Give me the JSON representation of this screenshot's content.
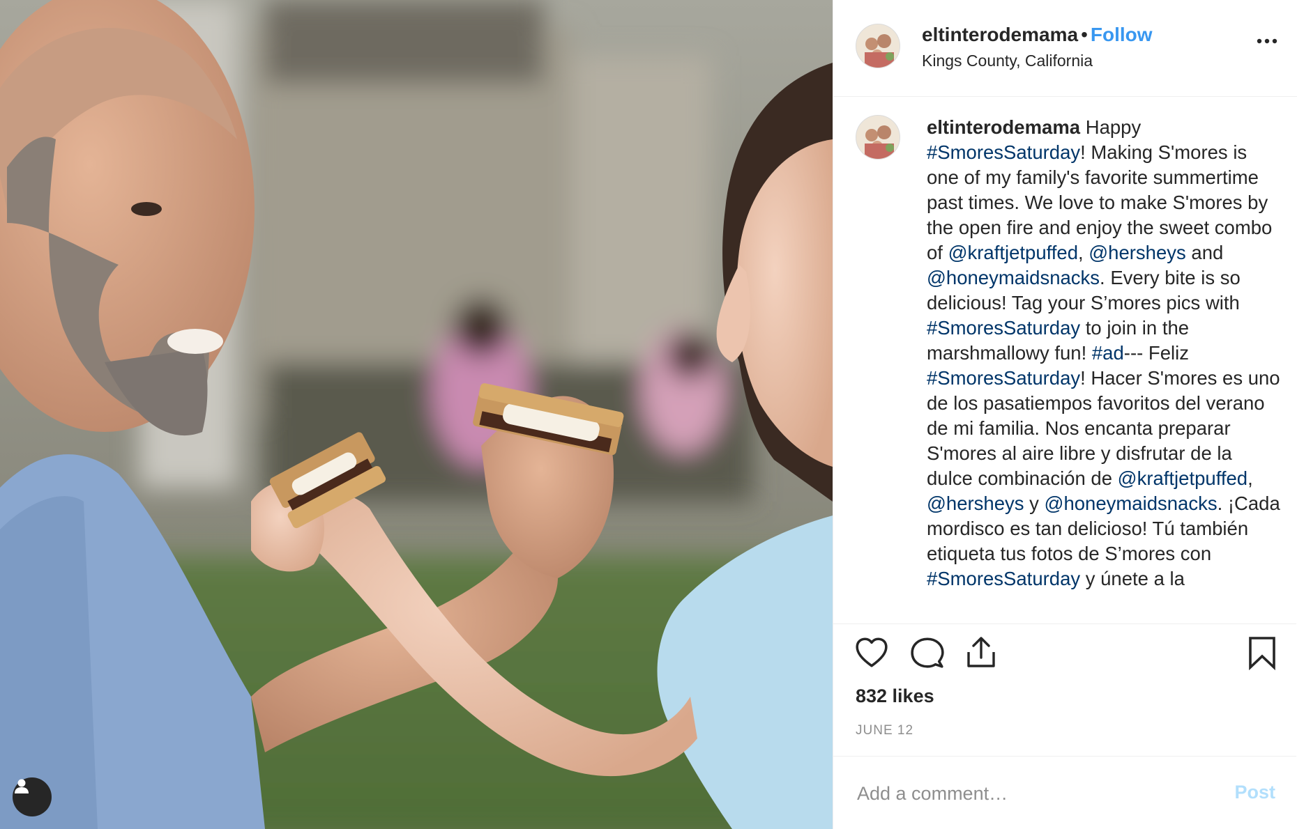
{
  "post": {
    "username": "eltinterodemama",
    "separator": "•",
    "follow_label": "Follow",
    "location": "Kings County, California",
    "more_icon": "more-horizontal-icon",
    "caption": [
      {
        "t": "text",
        "v": " Happy "
      },
      {
        "t": "link",
        "v": "#SmoresSaturday"
      },
      {
        "t": "text",
        "v": "! Making S'mores is one of my family's favorite summertime past times. We love to make S'mores by the open fire and enjoy the sweet combo of "
      },
      {
        "t": "link",
        "v": "@kraftjetpuffed"
      },
      {
        "t": "text",
        "v": ", "
      },
      {
        "t": "link",
        "v": "@hersheys"
      },
      {
        "t": "text",
        "v": " and "
      },
      {
        "t": "link",
        "v": "@honeymaidsnacks"
      },
      {
        "t": "text",
        "v": ". Every bite is so delicious! Tag your S’mores pics with "
      },
      {
        "t": "link",
        "v": "#SmoresSaturday"
      },
      {
        "t": "text",
        "v": " to join in the marshmallowy fun! "
      },
      {
        "t": "link",
        "v": "#ad"
      },
      {
        "t": "text",
        "v": "--- Feliz "
      },
      {
        "t": "link",
        "v": "#SmoresSaturday"
      },
      {
        "t": "text",
        "v": "! Hacer S'mores es uno de los pasatiempos favoritos del verano de mi familia. Nos encanta preparar S'mores al aire libre y disfrutar de la dulce combinación de "
      },
      {
        "t": "link",
        "v": "@kraftjetpuffed"
      },
      {
        "t": "text",
        "v": ", "
      },
      {
        "t": "link",
        "v": "@hersheys"
      },
      {
        "t": "text",
        "v": " y "
      },
      {
        "t": "link",
        "v": "@honeymaidsnacks"
      },
      {
        "t": "text",
        "v": ". ¡Cada mordisco es tan delicioso! Tú también etiqueta tus fotos de S’mores con "
      },
      {
        "t": "link",
        "v": "#SmoresSaturday"
      },
      {
        "t": "text",
        "v": " y únete a la"
      }
    ],
    "likes": "832 likes",
    "date": "JUNE 12",
    "comment_placeholder": "Add a comment…",
    "post_label": "Post"
  },
  "icons": {
    "like": "heart-icon",
    "comment": "comment-bubble-icon",
    "share": "share-icon",
    "save": "bookmark-icon",
    "tag_user": "user-icon"
  },
  "colors": {
    "link": "#003569",
    "follow": "#3897f0",
    "post_disabled": "#b2dffc",
    "muted": "#8e8e8e",
    "border": "#efefef"
  }
}
